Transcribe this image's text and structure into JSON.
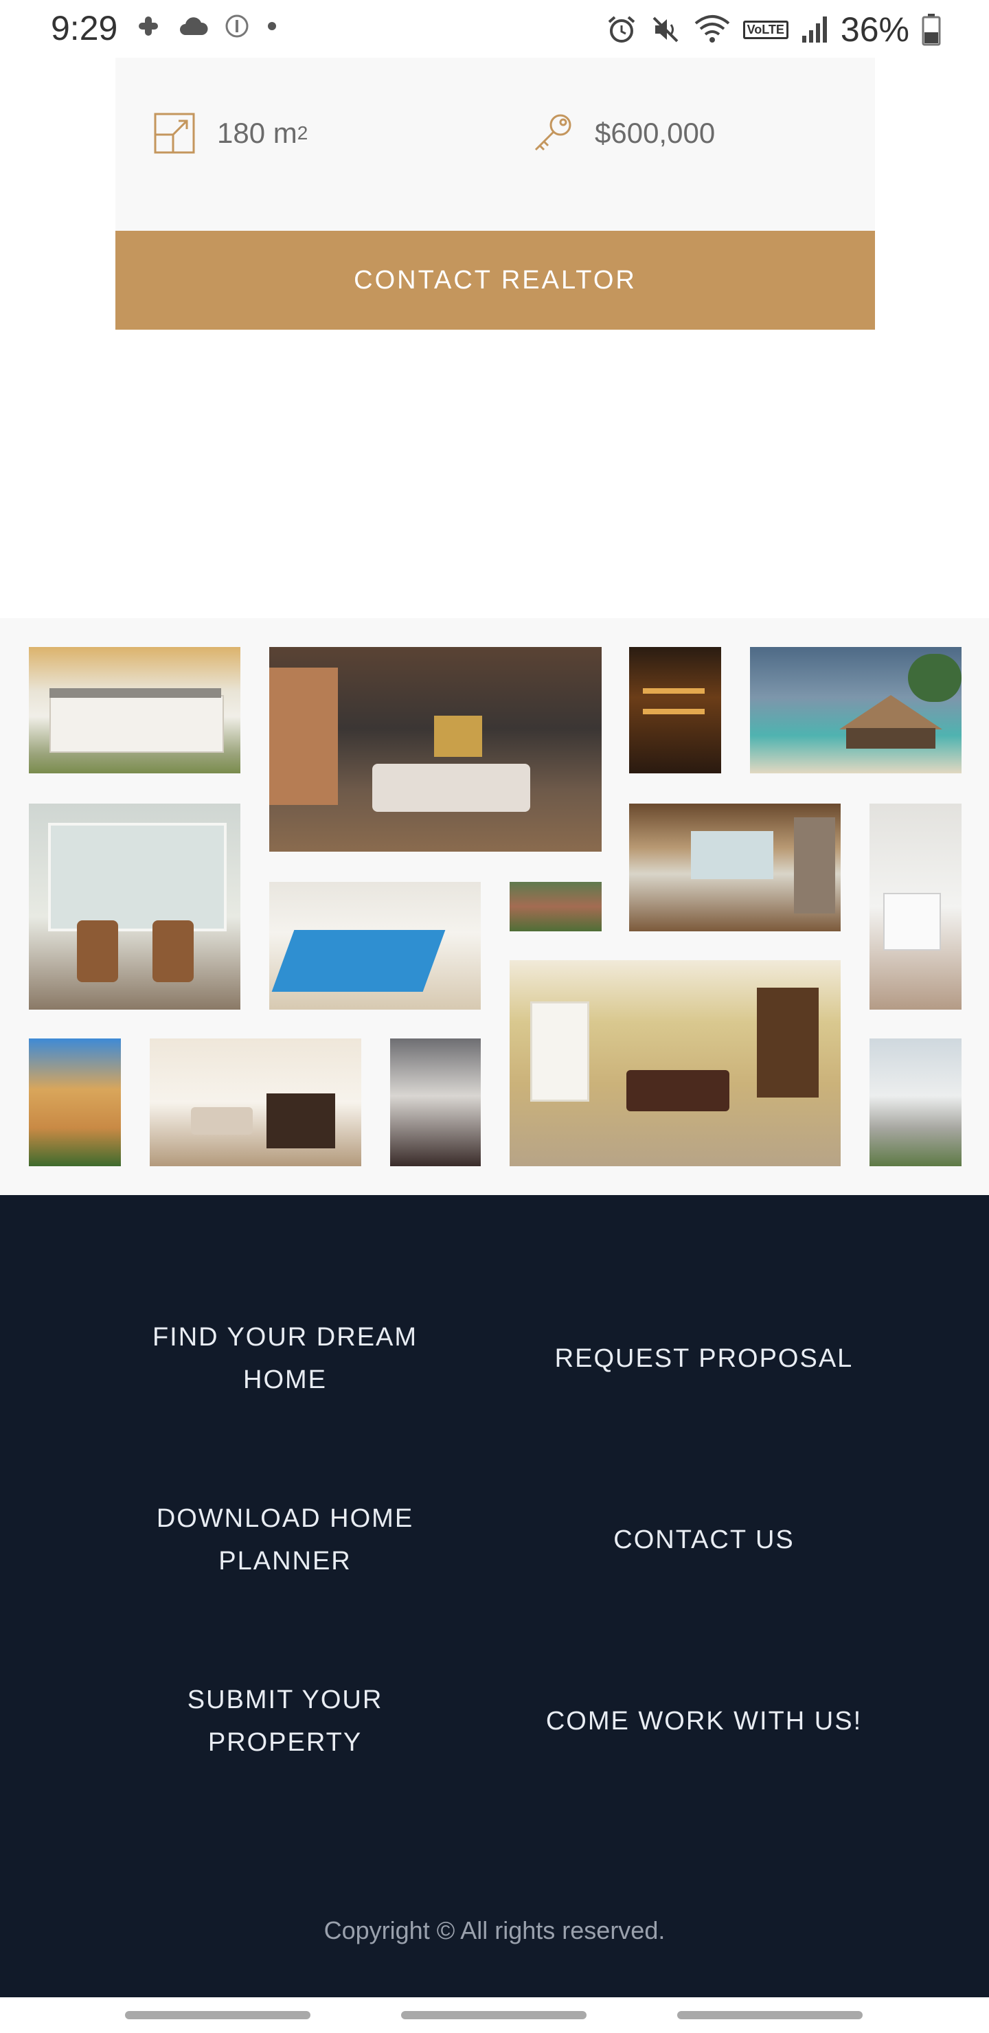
{
  "status_bar": {
    "time": "9:29",
    "battery": "36%",
    "network_badge": "VoLTE",
    "left_icons": [
      "slack-icon",
      "cloud-icon",
      "info-circle-icon",
      "dot-icon"
    ],
    "right_icons": [
      "alarm-icon",
      "mute-icon",
      "wifi-icon",
      "signal-icon",
      "battery-icon"
    ]
  },
  "property": {
    "area_value": "180 m",
    "area_unit_sup": "2",
    "price": "$600,000",
    "accent_color": "#c4965d"
  },
  "contact_button": {
    "label": "CONTACT REALTOR"
  },
  "gallery": {
    "photos": [
      "white-mansion-autumn-photo",
      "living-room-photo",
      "bar-interior-photo",
      "beach-bungalow-photo",
      "window-sitting-room-photo",
      "indoor-pool-photo",
      "brick-house-photo",
      "great-room-photo",
      "white-kitchen-photo",
      "billiard-room-photo",
      "spanish-villa-photo",
      "dining-kitchen-photo",
      "dark-lounge-photo",
      "white-house-photo"
    ]
  },
  "footer": {
    "links": [
      {
        "line1": "FIND YOUR DREAM",
        "line2": "HOME"
      },
      {
        "line1": "REQUEST PROPOSAL",
        "line2": ""
      },
      {
        "line1": "DOWNLOAD HOME",
        "line2": "PLANNER"
      },
      {
        "line1": "CONTACT US",
        "line2": ""
      },
      {
        "line1": "SUBMIT YOUR",
        "line2": "PROPERTY"
      },
      {
        "line1": "COME WORK WITH US!",
        "line2": ""
      }
    ],
    "copyright": "Copyright © All rights reserved.",
    "background_color": "#111a29"
  }
}
